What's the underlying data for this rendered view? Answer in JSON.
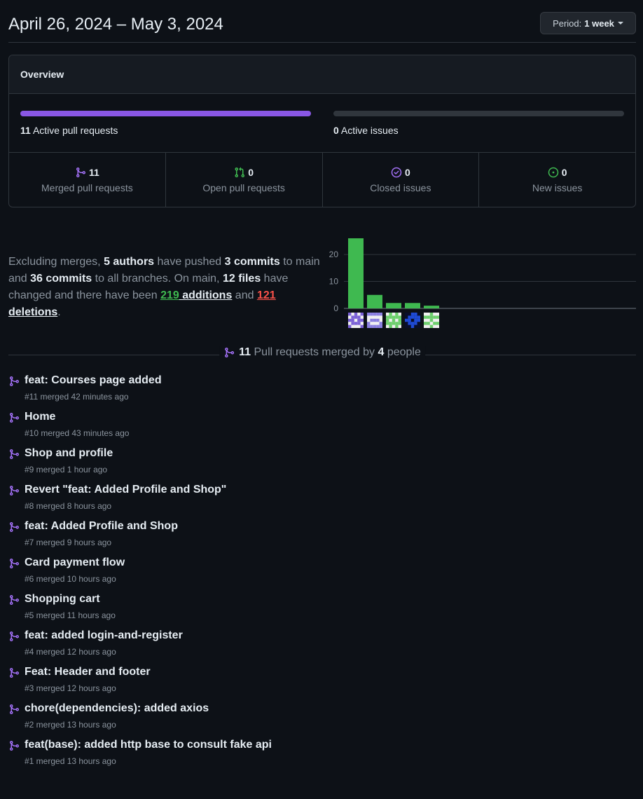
{
  "header": {
    "date_range": "April 26, 2024 – May 3, 2024",
    "period_label": "Period:",
    "period_value": "1 week"
  },
  "overview": {
    "title": "Overview",
    "active_prs_count": "11",
    "active_prs_label": "Active pull requests",
    "active_prs_fill": 1.0,
    "active_issues_count": "0",
    "active_issues_label": "Active issues",
    "active_issues_fill": 0.0,
    "stats": [
      {
        "count": "11",
        "label": "Merged pull requests",
        "icon": "merged-icon",
        "color": "#a371f7"
      },
      {
        "count": "0",
        "label": "Open pull requests",
        "icon": "pull-request-icon",
        "color": "#3fb950"
      },
      {
        "count": "0",
        "label": "Closed issues",
        "icon": "issue-closed-icon",
        "color": "#a371f7"
      },
      {
        "count": "0",
        "label": "New issues",
        "icon": "issue-opened-icon",
        "color": "#3fb950"
      }
    ]
  },
  "summary": {
    "t1": "Excluding merges, ",
    "authors": "5 authors",
    "t2": " have pushed ",
    "commits_main": "3 commits",
    "t3": " to main and ",
    "commits_all": "36 commits",
    "t4": " to all branches. On main, ",
    "files": "12 files",
    "t5": " have changed and there have been ",
    "additions_num": "219",
    "additions_word": " additions",
    "t6": " and ",
    "deletions_num": "121",
    "deletions_word": " deletions",
    "t7": "."
  },
  "chart_data": {
    "type": "bar",
    "categories": [
      "author-1",
      "author-2",
      "author-3",
      "author-4",
      "author-5"
    ],
    "values": [
      26,
      5,
      2,
      2,
      1
    ],
    "yticks": [
      "0",
      "10",
      "20"
    ],
    "ylim": [
      0,
      26
    ],
    "grid": true,
    "bar_color": "#3fb950"
  },
  "avatars": [
    {
      "color": "#7b61d6"
    },
    {
      "color": "#8a7fe0"
    },
    {
      "color": "#6ccf6c"
    },
    {
      "color": "#1f4bd6"
    },
    {
      "color": "#6ccf6c"
    }
  ],
  "divider": {
    "count": "11",
    "t1": " Pull requests merged by ",
    "people": "4",
    "t2": " people"
  },
  "pull_requests": [
    {
      "title": "feat: Courses page added",
      "meta": "#11 merged 42 minutes ago"
    },
    {
      "title": "Home",
      "meta": "#10 merged 43 minutes ago"
    },
    {
      "title": "Shop and profile",
      "meta": "#9 merged 1 hour ago"
    },
    {
      "title": "Revert \"feat: Added Profile and Shop\"",
      "meta": "#8 merged 8 hours ago"
    },
    {
      "title": "feat: Added Profile and Shop",
      "meta": "#7 merged 9 hours ago"
    },
    {
      "title": "Card payment flow",
      "meta": "#6 merged 10 hours ago"
    },
    {
      "title": "Shopping cart",
      "meta": "#5 merged 11 hours ago"
    },
    {
      "title": "feat: added login-and-register",
      "meta": "#4 merged 12 hours ago"
    },
    {
      "title": "Feat: Header and footer",
      "meta": "#3 merged 12 hours ago"
    },
    {
      "title": "chore(dependencies): added axios",
      "meta": "#2 merged 13 hours ago"
    },
    {
      "title": "feat(base): added http base to consult fake api",
      "meta": "#1 merged 13 hours ago"
    }
  ]
}
